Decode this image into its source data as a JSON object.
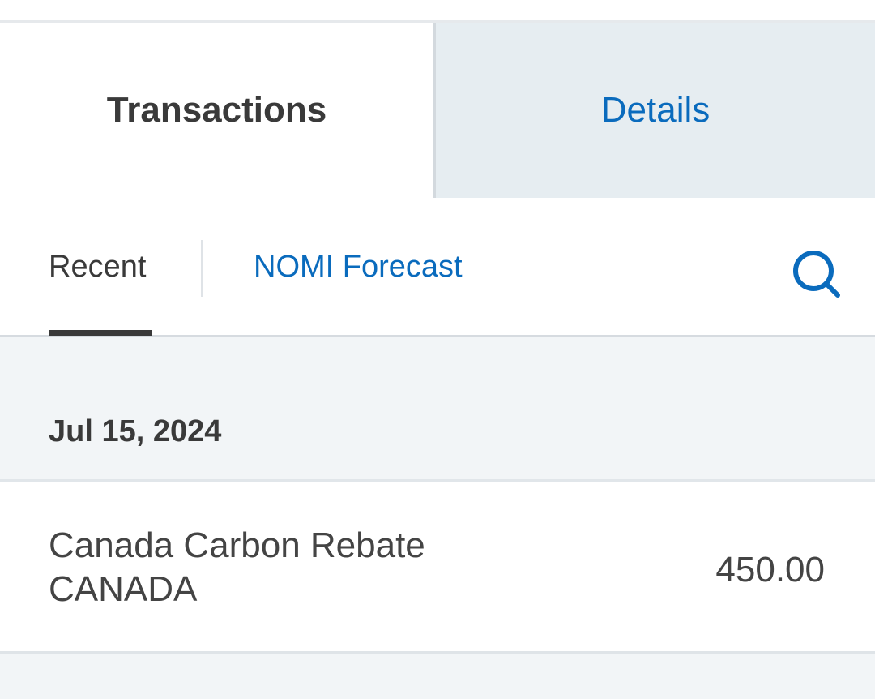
{
  "tabs": {
    "transactions": "Transactions",
    "details": "Details"
  },
  "subtabs": {
    "recent": "Recent",
    "forecast": "NOMI Forecast",
    "search_icon": "search-icon"
  },
  "colors": {
    "accent": "#0a6bbd",
    "text_dark": "#3a3a3a",
    "inactive_tab_bg": "#e6edf1",
    "section_bg": "#f2f5f7"
  },
  "transactions": [
    {
      "date": "Jul 15, 2024",
      "description_line1": "Canada Carbon Rebate",
      "description_line2": "CANADA",
      "amount": "450.00"
    }
  ]
}
